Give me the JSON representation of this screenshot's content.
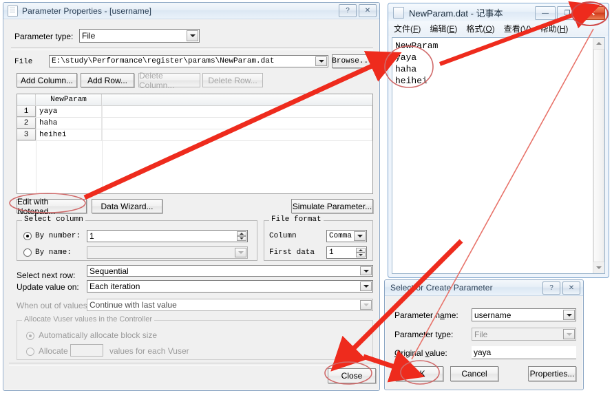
{
  "param_props": {
    "title": "Parameter Properties - [username]",
    "help_btn": "?",
    "close_btn": "✕",
    "param_type_label": "Parameter type:",
    "param_type_value": "File",
    "file_label": "File",
    "file_value": "E:\\study\\Performance\\register\\params\\NewParam.dat",
    "browse_label": "Browse...",
    "buttons": [
      {
        "label": "Add Column...",
        "disabled": false
      },
      {
        "label": "Add Row...",
        "disabled": false
      },
      {
        "label": "Delete Column...",
        "disabled": true
      },
      {
        "label": "Delete Row...",
        "disabled": true
      }
    ],
    "grid": {
      "column_header": "NewParam",
      "rows": [
        {
          "num": "1",
          "value": "yaya"
        },
        {
          "num": "2",
          "value": "haha"
        },
        {
          "num": "3",
          "value": "heihei"
        }
      ]
    },
    "edit_notepad_label": "Edit with Notepad...",
    "data_wizard_label": "Data Wizard...",
    "simulate_label": "Simulate Parameter...",
    "select_column": {
      "group_title": "Select column",
      "by_number_label": "By number:",
      "by_number_value": "1",
      "by_number_selected": true,
      "by_name_label": "By name:",
      "by_name_value": "",
      "by_name_selected": false
    },
    "file_format": {
      "group_title": "File format",
      "column_label": "Column",
      "column_value": "Comma",
      "first_data_label": "First data",
      "first_data_value": "1"
    },
    "select_next_row_label": "Select next row:",
    "select_next_row_value": "Sequential",
    "update_value_on_label": "Update value on:",
    "update_value_on_value": "Each iteration",
    "when_out_label": "When out of values:",
    "when_out_value": "Continue with last value",
    "allocate": {
      "group_title": "Allocate Vuser values in the Controller",
      "auto_label": "Automatically allocate block size",
      "auto_selected": true,
      "alloc_label": "Allocate",
      "alloc_value": "",
      "alloc_suffix": "values for each Vuser",
      "alloc_selected": false
    },
    "close_label": "Close"
  },
  "notepad": {
    "title": "NewParam.dat - 记事本",
    "minimize_btn": "—",
    "maximize_btn": "❐",
    "close_btn": "✕",
    "menu": [
      {
        "pre": "文件(",
        "key": "F",
        "post": ")"
      },
      {
        "pre": "编辑(",
        "key": "E",
        "post": ")"
      },
      {
        "pre": "格式(",
        "key": "O",
        "post": ")"
      },
      {
        "pre": "查看(",
        "key": "V",
        "post": ")"
      },
      {
        "pre": "帮助(",
        "key": "H",
        "post": ")"
      }
    ],
    "lines": [
      "NewParam",
      "yaya",
      "haha",
      "heihei"
    ]
  },
  "select_create": {
    "title": "Select or Create Parameter",
    "help_btn": "?",
    "close_btn": "✕",
    "param_name_label": "Parameter name:",
    "param_name_value": "username",
    "param_type_label": "Parameter type:",
    "param_type_value": "File",
    "original_value_label": "Original value:",
    "original_value_value": "yaya",
    "ok_label": "OK",
    "cancel_label": "Cancel",
    "properties_label": "Properties..."
  },
  "annotations": {
    "highlight_color": "#ee2b1d",
    "circle_color": "#d06a6a",
    "circled_items": [
      "edit-with-notepad-button",
      "notepad-text-values",
      "notepad-close-button",
      "close-button",
      "ok-button"
    ]
  }
}
